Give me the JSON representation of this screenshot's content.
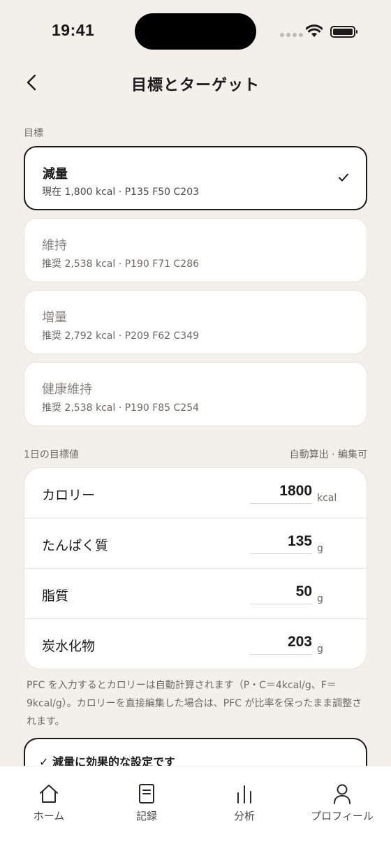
{
  "status": {
    "time": "19:41"
  },
  "header": {
    "title": "目標とターゲット"
  },
  "goal_section": {
    "label": "目標",
    "options": [
      {
        "name": "減量",
        "detail": "現在 1,800 kcal · P135 F50 C203",
        "selected": true
      },
      {
        "name": "維持",
        "detail": "推奨 2,538 kcal · P190 F71 C286",
        "selected": false
      },
      {
        "name": "増量",
        "detail": "推奨 2,792 kcal · P209 F62 C349",
        "selected": false
      },
      {
        "name": "健康維持",
        "detail": "推奨 2,538 kcal · P190 F85 C254",
        "selected": false
      }
    ]
  },
  "targets": {
    "label": "1日の目標値",
    "hint": "自動算出 · 編集可",
    "rows": [
      {
        "label": "カロリー",
        "value": "1800",
        "unit": "kcal"
      },
      {
        "label": "たんぱく質",
        "value": "135",
        "unit": "g"
      },
      {
        "label": "脂質",
        "value": "50",
        "unit": "g"
      },
      {
        "label": "炭水化物",
        "value": "203",
        "unit": "g"
      }
    ]
  },
  "note": "PFC を入力するとカロリーは自動計算されます（P・C＝4kcal/g、F＝9kcal/g）。カロリーを直接編集した場合は、PFC が比率を保ったまま調整されます。",
  "advice": {
    "title": "✓ 減量に効果的な設定です"
  },
  "tabs": [
    {
      "label": "ホーム",
      "icon": "home-icon"
    },
    {
      "label": "記録",
      "icon": "document-icon"
    },
    {
      "label": "分析",
      "icon": "bar-chart-icon"
    },
    {
      "label": "プロフィール",
      "icon": "person-icon"
    }
  ],
  "colors": {
    "background": "#f3f0eb",
    "card": "#ffffff",
    "accent": "#1a1a1a",
    "muted": "#6d6a66"
  }
}
